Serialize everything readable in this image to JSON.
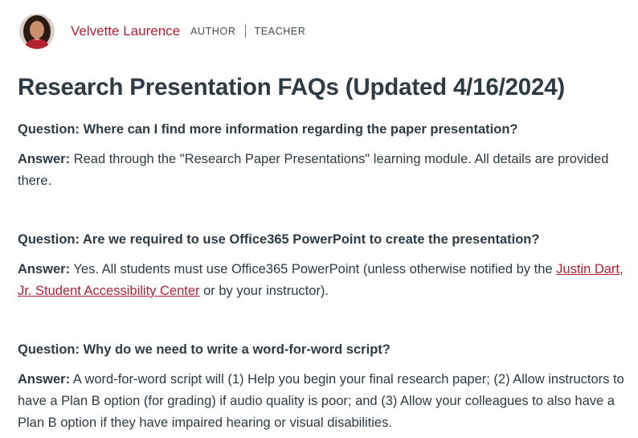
{
  "author": {
    "name": "Velvette Laurence",
    "roles": [
      "AUTHOR",
      "TEACHER"
    ]
  },
  "page": {
    "title": "Research Presentation FAQs (Updated 4/16/2024)"
  },
  "faqs": [
    {
      "question": "Question: Where can I find more information regarding the paper presentation?",
      "answer_label": "Answer:",
      "answer_text": " Read through the \"Research Paper Presentations\" learning module. All details are provided there."
    },
    {
      "question": "Question:  Are we required to use Office365 PowerPoint to create the presentation?",
      "answer_label": "Answer:",
      "answer_before": "  Yes. All students must use Office365 PowerPoint (unless otherwise notified by the ",
      "answer_link": "Justin Dart, Jr. Student Accessibility Center",
      "answer_after": " or by your instructor)."
    },
    {
      "question": "Question: Why do we need to write a word-for-word script?",
      "answer_label": "Answer:",
      "answer_text": " A word-for-word script will (1) Help you begin your final research paper; (2) Allow instructors to have a Plan B option (for grading) if audio quality is poor; and (3) Allow your colleagues to also have a Plan B option if they have impaired hearing or visual disabilities."
    }
  ],
  "colors": {
    "accent": "#b51f36",
    "text": "#2d3b45"
  }
}
